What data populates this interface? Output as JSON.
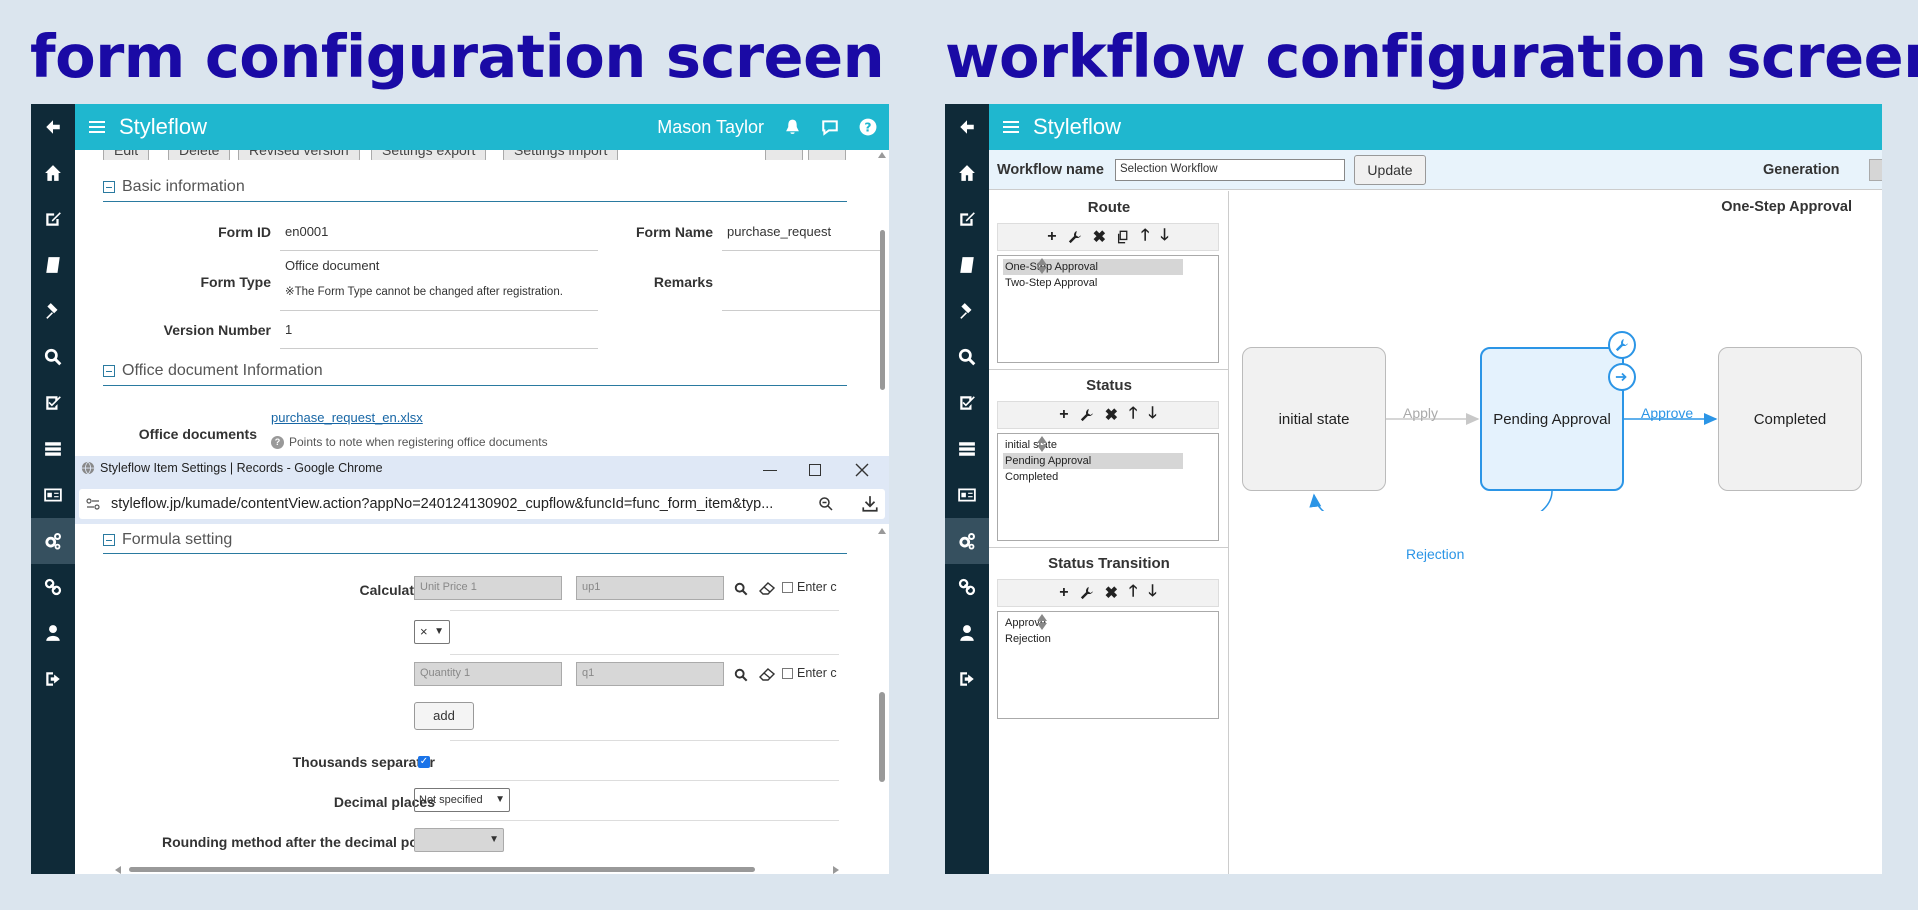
{
  "headings": {
    "left": "form configuration screen",
    "right": "workflow configuration screen"
  },
  "left_panel": {
    "brand": "Styleflow",
    "user": "Mason Taylor",
    "toolbar_buttons": [
      "Edit",
      "Delete",
      "Revised version",
      "Settings export",
      "Settings import"
    ],
    "basic_section": "Basic information",
    "form_id_label": "Form ID",
    "form_id": "en0001",
    "form_name_label": "Form Name",
    "form_name": "purchase_request",
    "form_type_label": "Form Type",
    "form_type": "Office document",
    "form_type_note": "※The Form Type cannot be changed after registration.",
    "remarks_label": "Remarks",
    "version_label": "Version Number",
    "version": "1",
    "office_section": "Office document Information",
    "office_docs_label": "Office documents",
    "office_file": "purchase_request_en.xlsx",
    "office_note": "Points to note when registering office documents"
  },
  "popup": {
    "window_title": "Styleflow Item Settings | Records - Google Chrome",
    "url": "styleflow.jp/kumade/contentView.action?appNo=240124130902_cupflow&funcId=func_form_item&typ...",
    "formula_section": "Formula setting",
    "calculation_label": "Calculation",
    "calc1_name": "Unit Price 1",
    "calc1_code": "up1",
    "enter_label": "Enter c",
    "operator": "×",
    "calc2_name": "Quantity 1",
    "calc2_code": "q1",
    "add_label": "add",
    "thousands_label": "Thousands separator",
    "thousands_checked": true,
    "decimal_label": "Decimal places",
    "decimal_value": "Not specified",
    "rounding_label": "Rounding method after the decimal point",
    "rounding_value": ""
  },
  "right_panel": {
    "brand": "Styleflow",
    "workflow_name_label": "Workflow name",
    "workflow_name": "Selection Workflow",
    "update_label": "Update",
    "generation_label": "Generation",
    "route_title": "Route",
    "route_items": [
      "One-Step Approval",
      "Two-Step Approval"
    ],
    "status_title": "Status",
    "status_items": [
      "initial state",
      "Pending Approval",
      "Completed"
    ],
    "transition_title": "Status Transition",
    "transition_items": [
      "Approve",
      "Rejection"
    ],
    "diagram_title": "One-Step Approval",
    "nodes": [
      "initial state",
      "Pending Approval",
      "Completed"
    ],
    "edge_apply": "Apply",
    "edge_approve": "Approve",
    "edge_rejection": "Rejection",
    "accent_color": "#2b95e6"
  }
}
